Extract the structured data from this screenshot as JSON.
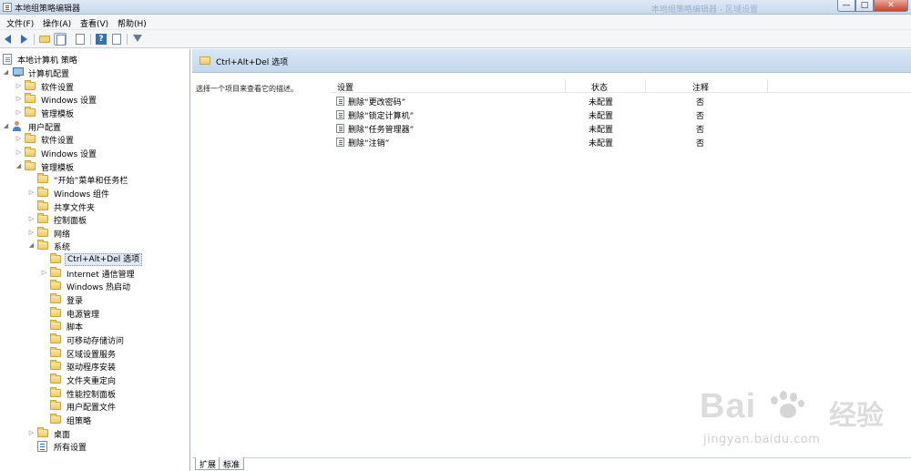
{
  "window": {
    "title": "本地组策略编辑器",
    "ghost_title": "本地组策略编辑器 - 区域设置",
    "buttons": {
      "minimize": "—",
      "maximize": "□",
      "close": "✕"
    }
  },
  "menu": [
    "文件(F)",
    "操作(A)",
    "查看(V)",
    "帮助(H)"
  ],
  "toolbar": {
    "icons": [
      "back-icon",
      "forward-icon",
      "up-folder-icon",
      "show-hide-tree-icon",
      "export-list-icon",
      "help-icon",
      "properties-icon",
      "filter-icon"
    ]
  },
  "tree": {
    "root": "本地计算机 策略",
    "items": [
      {
        "label": "计算机配置",
        "icon": "computer-icon",
        "expander": "◢"
      },
      {
        "label": "软件设置",
        "icon": "folder-icon",
        "expander": "▷"
      },
      {
        "label": "Windows 设置",
        "icon": "folder-icon",
        "expander": "▷"
      },
      {
        "label": "管理模板",
        "icon": "folder-icon",
        "expander": "▷"
      },
      {
        "label": "用户配置",
        "icon": "user-icon",
        "expander": "◢"
      },
      {
        "label": "软件设置",
        "icon": "folder-icon",
        "expander": "▷"
      },
      {
        "label": "Windows 设置",
        "icon": "folder-icon",
        "expander": "▷"
      },
      {
        "label": "管理模板",
        "icon": "folder-icon",
        "expander": "◢"
      },
      {
        "label": "“开始”菜单和任务栏",
        "icon": "folder-icon",
        "expander": ""
      },
      {
        "label": "Windows 组件",
        "icon": "folder-icon",
        "expander": "▷"
      },
      {
        "label": "共享文件夹",
        "icon": "folder-icon",
        "expander": ""
      },
      {
        "label": "控制面板",
        "icon": "folder-icon",
        "expander": "▷"
      },
      {
        "label": "网络",
        "icon": "folder-icon",
        "expander": "▷"
      },
      {
        "label": "系统",
        "icon": "folder-icon",
        "expander": "◢"
      },
      {
        "label": "Ctrl+Alt+Del 选项",
        "icon": "folder-icon",
        "expander": "",
        "selected": true
      },
      {
        "label": "Internet 通信管理",
        "icon": "folder-icon",
        "expander": "▷"
      },
      {
        "label": "Windows 热启动",
        "icon": "folder-icon",
        "expander": ""
      },
      {
        "label": "登录",
        "icon": "folder-icon",
        "expander": ""
      },
      {
        "label": "电源管理",
        "icon": "folder-icon",
        "expander": ""
      },
      {
        "label": "脚本",
        "icon": "folder-icon",
        "expander": ""
      },
      {
        "label": "可移动存储访问",
        "icon": "folder-icon",
        "expander": ""
      },
      {
        "label": "区域设置服务",
        "icon": "folder-icon",
        "expander": ""
      },
      {
        "label": "驱动程序安装",
        "icon": "folder-icon",
        "expander": ""
      },
      {
        "label": "文件夹重定向",
        "icon": "folder-icon",
        "expander": ""
      },
      {
        "label": "性能控制面板",
        "icon": "folder-icon",
        "expander": ""
      },
      {
        "label": "用户配置文件",
        "icon": "folder-icon",
        "expander": ""
      },
      {
        "label": "组策略",
        "icon": "folder-icon",
        "expander": ""
      },
      {
        "label": "桌面",
        "icon": "folder-icon",
        "expander": "▷"
      },
      {
        "label": "所有设置",
        "icon": "all-settings-icon",
        "expander": ""
      }
    ]
  },
  "detail": {
    "header_title": "Ctrl+Alt+Del 选项",
    "description": "选择一个项目来查看它的描述。",
    "columns": {
      "setting": "设置",
      "state": "状态",
      "comment": "注释"
    },
    "rows": [
      {
        "setting": "删除“更改密码”",
        "state": "未配置",
        "comment": "否"
      },
      {
        "setting": "删除“锁定计算机”",
        "state": "未配置",
        "comment": "否"
      },
      {
        "setting": "删除“任务管理器”",
        "state": "未配置",
        "comment": "否"
      },
      {
        "setting": "删除“注销”",
        "state": "未配置",
        "comment": "否"
      }
    ],
    "tabs": [
      "扩展",
      "标准"
    ]
  },
  "watermark": {
    "brand": "Bai",
    "brand_cn": "经验",
    "url": "jingyan.baidu.com"
  }
}
